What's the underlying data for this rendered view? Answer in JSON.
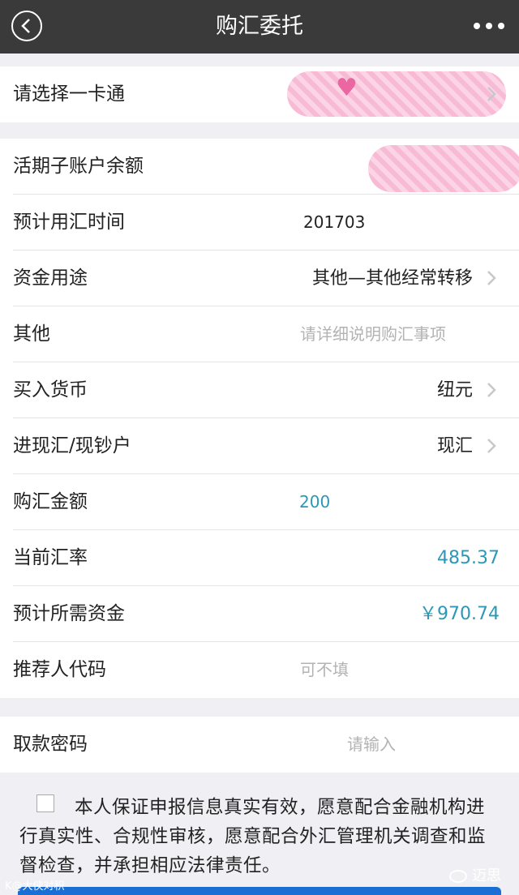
{
  "nav": {
    "title": "购汇委托",
    "back_icon": "chevron-left-icon",
    "more_icon": "more-dots-icon"
  },
  "card_select": {
    "label": "请选择一卡通",
    "value_obscured": true
  },
  "form": {
    "balance": {
      "label": "活期子账户余额",
      "value_obscured": true
    },
    "exchange_time": {
      "label": "预计用汇时间",
      "value": "201703"
    },
    "fund_purpose": {
      "label": "资金用途",
      "value": "其他—其他经常转移"
    },
    "other": {
      "label": "其他",
      "placeholder": "请详细说明购汇事项"
    },
    "buy_currency": {
      "label": "买入货币",
      "value": "纽元"
    },
    "account_type": {
      "label": "进现汇/现钞户",
      "value": "现汇"
    },
    "amount": {
      "label": "购汇金额",
      "value": "200"
    },
    "rate": {
      "label": "当前汇率",
      "value": "485.37"
    },
    "required_funds": {
      "label": "预计所需资金",
      "value": "￥970.74"
    },
    "referrer": {
      "label": "推荐人代码",
      "placeholder": "可不填"
    }
  },
  "password": {
    "label": "取款密码",
    "placeholder": "请输入"
  },
  "agreement": {
    "checked": false,
    "text": "本人保证申报信息真实有效，愿意配合金融机构进行真实性、合规性审核，愿意配合外汇管理机关调查和监督检查，并承担相应法律责任。"
  },
  "footer": {
    "left_watermark": "K@大侠对积",
    "right_watermark": "迈思"
  },
  "colors": {
    "navbar": "#3a3a3a",
    "accent_teal": "#2a98b6",
    "background": "#efeff4",
    "submit_blue": "#1a6fd4"
  }
}
